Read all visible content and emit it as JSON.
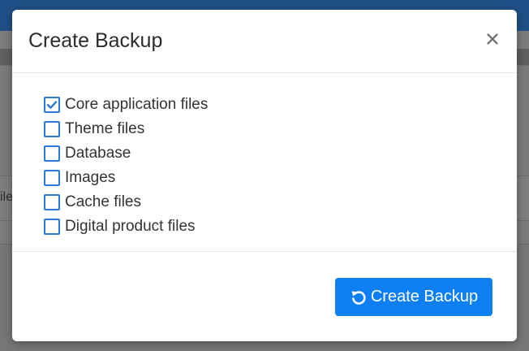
{
  "backdrop": {
    "partial_tab_text": "ile"
  },
  "modal": {
    "title": "Create Backup",
    "close_icon": "close-icon",
    "options": [
      {
        "label": "Core application files",
        "checked": true
      },
      {
        "label": "Theme files",
        "checked": false
      },
      {
        "label": "Database",
        "checked": false
      },
      {
        "label": "Images",
        "checked": false
      },
      {
        "label": "Cache files",
        "checked": false
      },
      {
        "label": "Digital product files",
        "checked": false
      }
    ],
    "primary_button": {
      "label": "Create Backup",
      "icon": "refresh-icon"
    }
  },
  "colors": {
    "primary": "#0d7ff2",
    "checkbox_border": "#2a7bd6",
    "topbar": "#1f4f86"
  }
}
